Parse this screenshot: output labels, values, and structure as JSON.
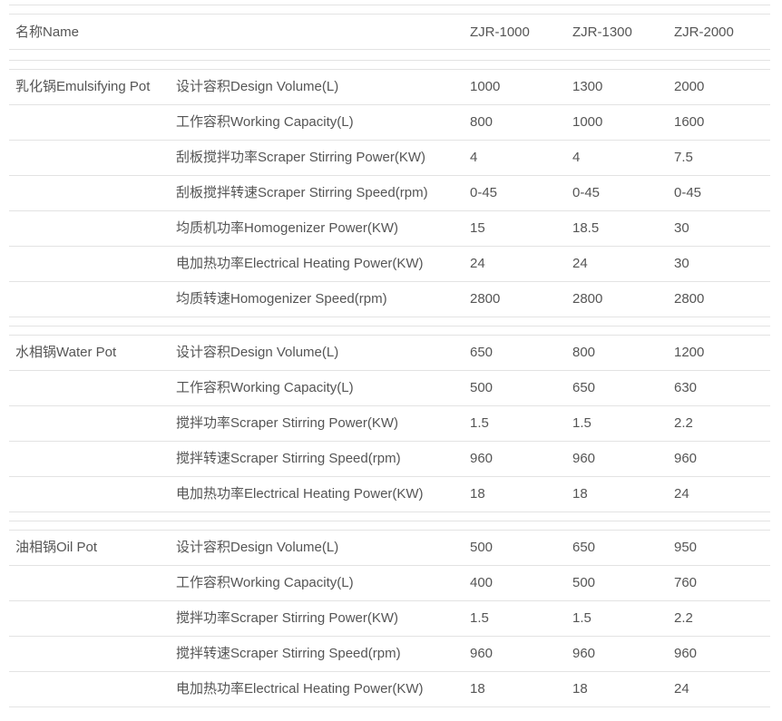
{
  "header": {
    "label": "名称Name",
    "models": [
      "ZJR-1000",
      "ZJR-1300",
      "ZJR-2000"
    ]
  },
  "sections": [
    {
      "name": "乳化锅Emulsifying Pot",
      "rows": [
        {
          "param": "设计容积Design Volume(L)",
          "values": [
            "1000",
            "1300",
            "2000"
          ]
        },
        {
          "param": "工作容积Working Capacity(L)",
          "values": [
            "800",
            "1000",
            "1600"
          ]
        },
        {
          "param": "刮板搅拌功率Scraper Stirring Power(KW)",
          "values": [
            "4",
            "4",
            "7.5"
          ]
        },
        {
          "param": "刮板搅拌转速Scraper Stirring Speed(rpm)",
          "values": [
            "0-45",
            "0-45",
            "0-45"
          ]
        },
        {
          "param": "均质机功率Homogenizer Power(KW)",
          "values": [
            "15",
            "18.5",
            "30"
          ]
        },
        {
          "param": "电加热功率Electrical Heating Power(KW)",
          "values": [
            "24",
            "24",
            "30"
          ]
        },
        {
          "param": "均质转速Homogenizer Speed(rpm)",
          "values": [
            "2800",
            "2800",
            "2800"
          ]
        }
      ]
    },
    {
      "name": "水相锅Water Pot",
      "rows": [
        {
          "param": "设计容积Design Volume(L)",
          "values": [
            "650",
            "800",
            "1200"
          ]
        },
        {
          "param": "工作容积Working Capacity(L)",
          "values": [
            "500",
            "650",
            "630"
          ]
        },
        {
          "param": "搅拌功率Scraper Stirring Power(KW)",
          "values": [
            "1.5",
            "1.5",
            "2.2"
          ]
        },
        {
          "param": "搅拌转速Scraper Stirring Speed(rpm)",
          "values": [
            "960",
            "960",
            "960"
          ]
        },
        {
          "param": "电加热功率Electrical Heating Power(KW)",
          "values": [
            "18",
            "18",
            "24"
          ]
        }
      ]
    },
    {
      "name": "油相锅Oil Pot",
      "rows": [
        {
          "param": "设计容积Design Volume(L)",
          "values": [
            "500",
            "650",
            "950"
          ]
        },
        {
          "param": "工作容积Working Capacity(L)",
          "values": [
            "400",
            "500",
            "760"
          ]
        },
        {
          "param": "搅拌功率Scraper Stirring Power(KW)",
          "values": [
            "1.5",
            "1.5",
            "2.2"
          ]
        },
        {
          "param": "搅拌转速Scraper Stirring Speed(rpm)",
          "values": [
            "960",
            "960",
            "960"
          ]
        },
        {
          "param": "电加热功率Electrical Heating Power(KW)",
          "values": [
            "18",
            "18",
            "24"
          ]
        }
      ]
    }
  ]
}
